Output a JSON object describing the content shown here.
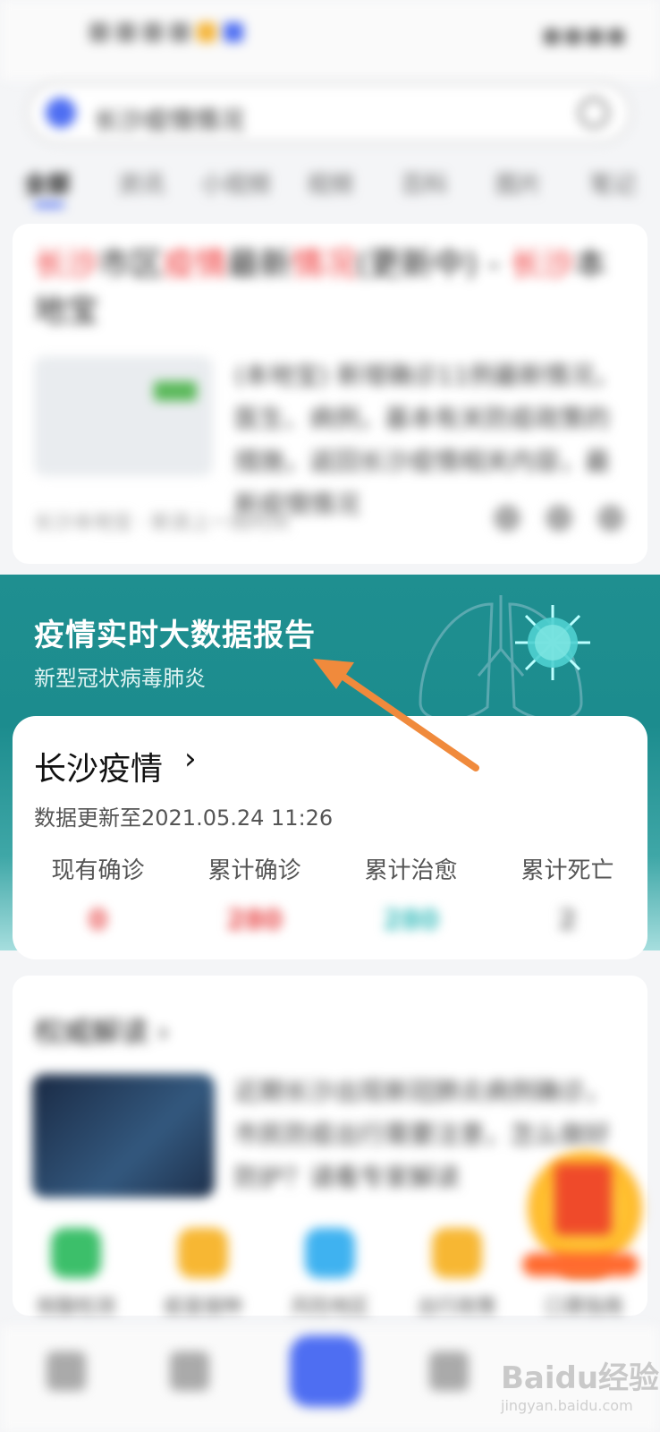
{
  "status_bar": {},
  "search": {
    "query": "长沙疫情情况"
  },
  "tabs": [
    {
      "label": "全部"
    },
    {
      "label": "资讯"
    },
    {
      "label": "小视频"
    },
    {
      "label": "视频"
    },
    {
      "label": "百科"
    },
    {
      "label": "图片"
    },
    {
      "label": "笔记"
    }
  ],
  "article": {
    "title_parts": [
      {
        "text": "长沙",
        "hl": true
      },
      {
        "text": "市区",
        "hl": false
      },
      {
        "text": "疫情",
        "hl": true
      },
      {
        "text": "最新",
        "hl": false
      },
      {
        "text": "情况",
        "hl": true
      },
      {
        "text": "(更新中) - ",
        "hl": false
      },
      {
        "text": "长沙",
        "hl": true
      },
      {
        "text": "本地宝",
        "hl": false
      }
    ],
    "desc": "(本地宝) 新增确诊11例最新情况，医生、病例，基本有关防疫政策的措施，返回长沙疫情相关内容，最新疫情情况",
    "meta": "长沙本地宝 · 新浪上一周时间"
  },
  "banner": {
    "title": "疫情实时大数据报告",
    "subtitle": "新型冠状病毒肺炎",
    "colors": {
      "bg_top": "#1f8f90",
      "bg_bottom": "#a6dede"
    }
  },
  "data_card": {
    "title": "长沙疫情",
    "chevron": "›",
    "update": "数据更新至2021.05.24 11:26",
    "stats": [
      {
        "label": "现有确诊",
        "value": "0",
        "color": "#e84a4a"
      },
      {
        "label": "累计确诊",
        "value": "280",
        "color": "#e84a4a"
      },
      {
        "label": "累计治愈",
        "value": "280",
        "color": "#3cbdbd"
      },
      {
        "label": "累计死亡",
        "value": "2",
        "color": "#888888"
      }
    ]
  },
  "card2": {
    "title": "权威解读 ›",
    "desc": "近期长沙出现新冠肺炎病例确诊，市民防疫出行需要注意，怎么做好防护？请看专家解读"
  },
  "shortcuts": [
    {
      "label": "核酸检测",
      "color": "#3cbf6a"
    },
    {
      "label": "疫苗接种",
      "color": "#f7b733"
    },
    {
      "label": "风险地区",
      "color": "#3fb2f0"
    },
    {
      "label": "出行政策",
      "color": "#f7b733"
    },
    {
      "label": "口罩指南",
      "color": "#f08040"
    }
  ],
  "watermark": {
    "brand": "Baidu经验",
    "url": "jingyan.baidu.com"
  }
}
